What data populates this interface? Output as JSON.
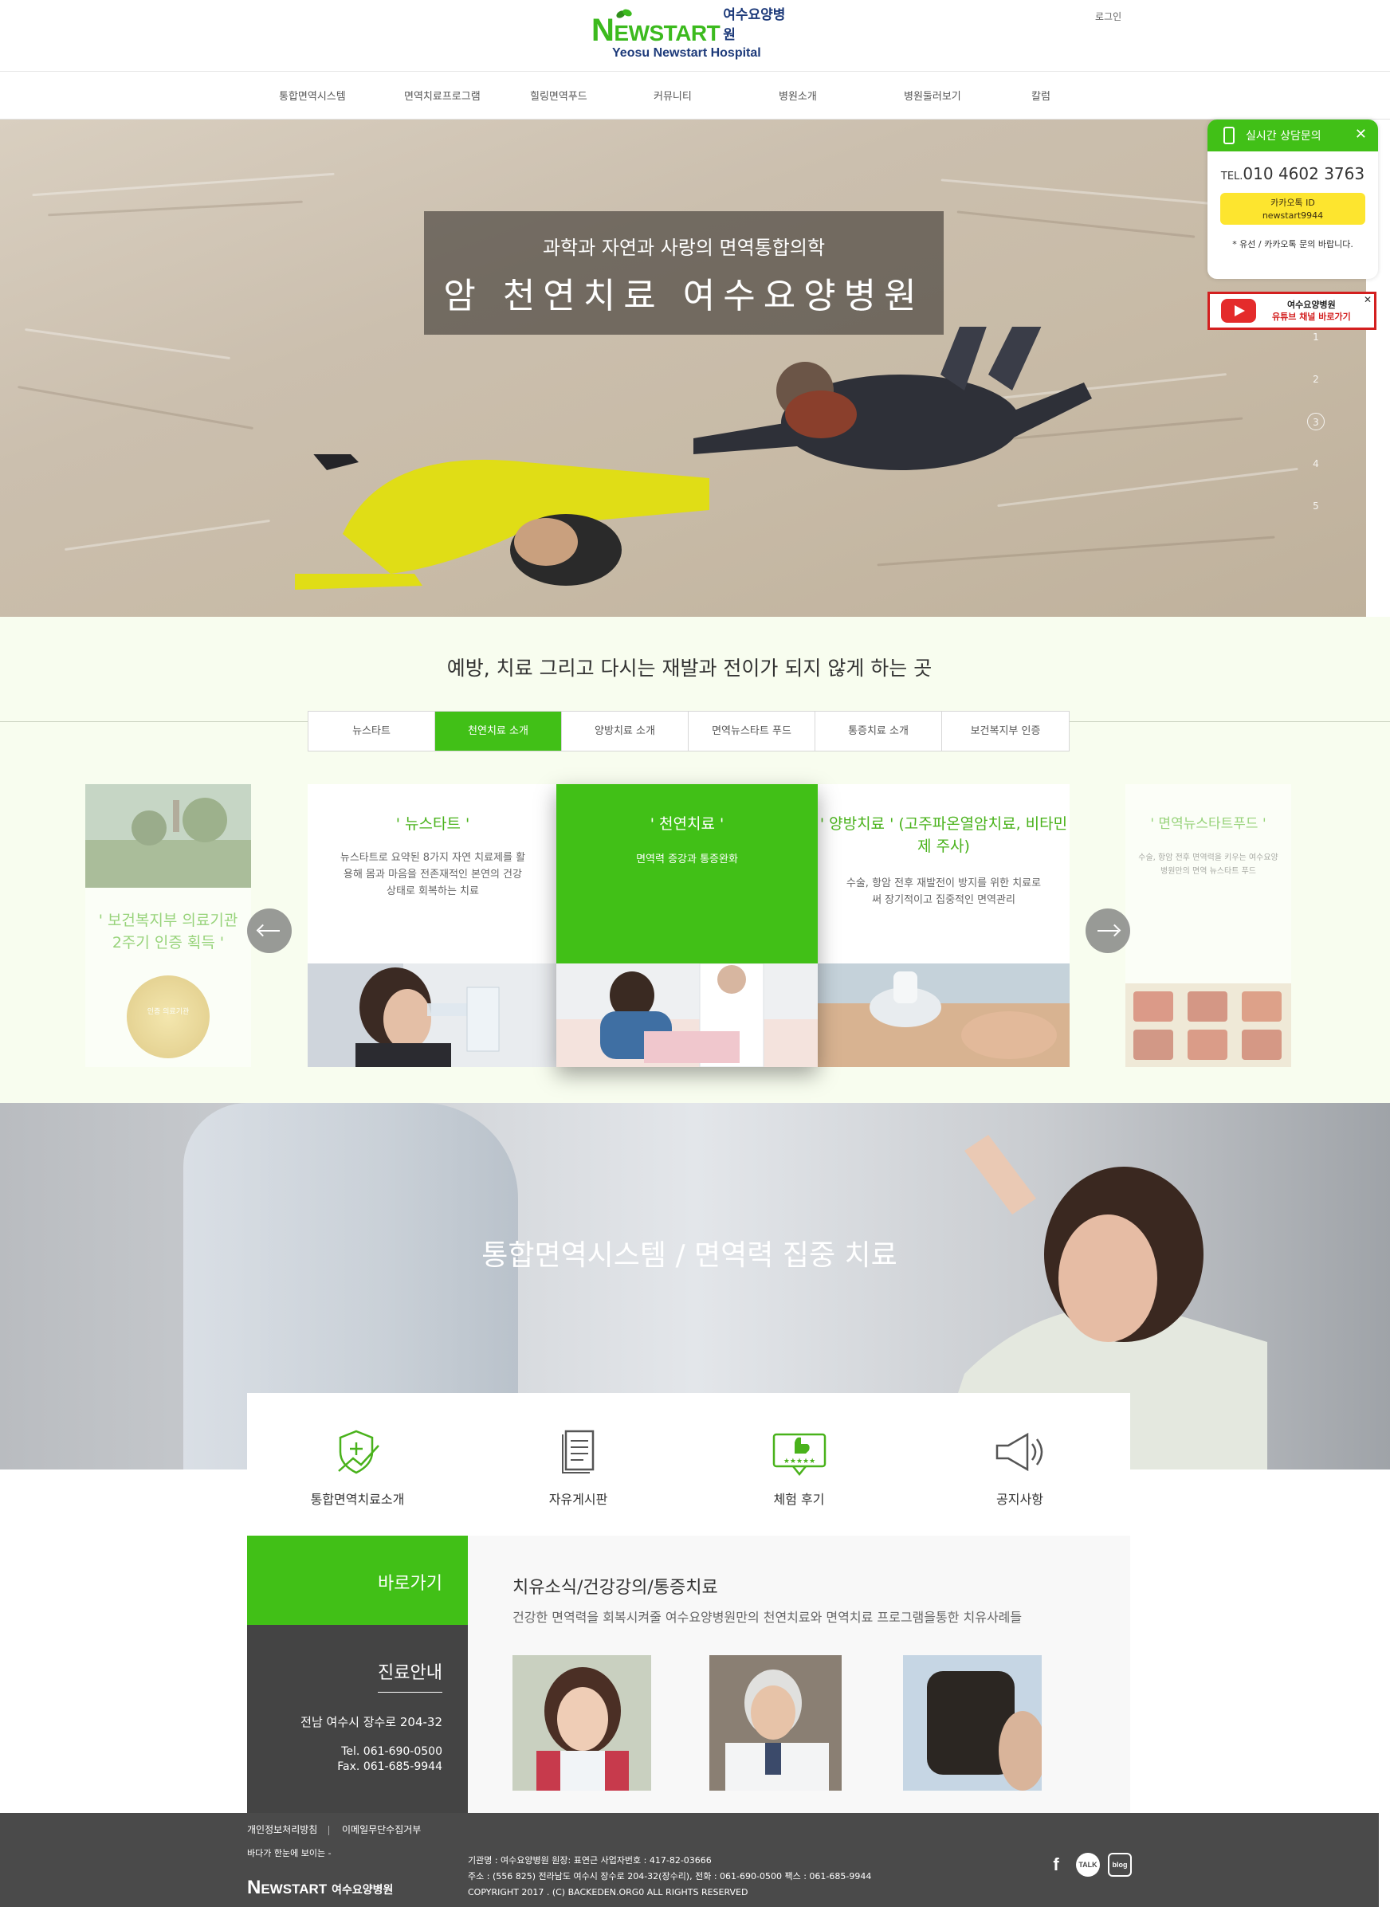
{
  "header": {
    "logo_brand_first": "N",
    "logo_brand_rest": "EWSTART",
    "logo_ko": "여수요양병원",
    "logo_en": "Yeosu Newstart Hospital",
    "login": "로그인"
  },
  "nav": [
    "통합면역시스템",
    "면역치료프로그램",
    "힐링면역푸드",
    "커뮤니티",
    "병원소개",
    "병원둘러보기",
    "칼럼"
  ],
  "hero": {
    "subtitle": "과학과 자연과 사랑의 면역통합의학",
    "title": "암 천연치료 여수요양병원",
    "slides": [
      "1",
      "2",
      "3",
      "4",
      "5"
    ],
    "active_slide": 3
  },
  "consult_widget": {
    "title": "실시간 상담문의",
    "close": "✕",
    "tel_prefix": "TEL.",
    "tel": "010 4602 3763",
    "kakao_label": "카카오톡 ID",
    "kakao_id": "newstart9944",
    "note": "* 유선 / 카카오톡 문의 바랍니다."
  },
  "youtube_banner": {
    "line1": "여수요양병원",
    "line2": "유튜브 채널 바로가기",
    "close": "✕"
  },
  "section2": {
    "headline": "예방, 치료 그리고 다시는 재발과 전이가 되지 않게 하는 곳",
    "tabs": [
      "뉴스타트",
      "천연치료 소개",
      "양방치료 소개",
      "면역뉴스타트 푸드",
      "통증치료 소개",
      "보건복지부 인증"
    ],
    "active_tab": 1,
    "cards": [
      {
        "title": "' 보건복지부 의료기관 2주기 인증 획득 '",
        "desc": "",
        "badge": "인증 의료기관"
      },
      {
        "title": "' 뉴스타트 '",
        "desc": "뉴스타트로 요약된 8가지 자연 치료제를 활용해 몸과 마음을 전존재적인 본연의 건강상태로 회복하는 치료"
      },
      {
        "title": "' 천연치료 '",
        "desc": "면역력 증강과 통증완화"
      },
      {
        "title": "' 양방치료 ' (고주파온열암치료, 비타민제 주사)",
        "desc": "수술, 항암 전후 재발전이 방지를 위한 치료로써 장기적이고 집중적인 면역관리"
      },
      {
        "title": "' 면역뉴스타트푸드 '",
        "desc": "수술, 항암 전후 면역력을 키우는 여수요양병원만의 면역 뉴스타트 푸드"
      }
    ]
  },
  "section3": {
    "headline": "통합면역시스템 / 면역력 집중 치료",
    "icons": [
      {
        "label": "통합면역치료소개",
        "icon": "shield-cross-icon"
      },
      {
        "label": "자유게시판",
        "icon": "document-icon"
      },
      {
        "label": "체험 후기",
        "icon": "thumbs-up-review-icon"
      },
      {
        "label": "공지사항",
        "icon": "megaphone-icon"
      }
    ]
  },
  "quick": {
    "label": "바로가기"
  },
  "clinic": {
    "heading": "진료안내",
    "address": "전남 여수시 장수로 204-32",
    "tel": "Tel. 061-690-0500",
    "fax": "Fax. 061-685-9944"
  },
  "news": {
    "title": "치유소식/건강강의/통증치료",
    "desc": "건강한 면역력을 회복시켜줄 여수요양병원만의 천연치료와 면역치료 프로그램을통한 치유사례들"
  },
  "footer": {
    "privacy": "개인정보처리방침",
    "email_policy": "이메일무단수집거부",
    "slogan": "바다가 한눈에 보이는 -",
    "logo_first": "N",
    "logo_rest": "EWSTART",
    "logo_ko": "여수요양병원",
    "info1": "기관명 : 여수요양병원 원장: 표연근 사업자번호 : 417-82-03666",
    "info2": "주소 : (556 825) 전라남도 여수시 장수로 204-32(장수리), 전화 : 061-690-0500 팩스 : 061-685-9944",
    "info3": "COPYRIGHT 2017 . (C) BACKEDEN.ORG0 ALL RIGHTS RESERVED",
    "social": [
      "f",
      "TALK",
      "blog"
    ]
  },
  "colors": {
    "brand_green": "#41c017",
    "brand_navy": "#1d3a7a",
    "dark_panel": "#444444",
    "footer_bg": "#4a4a4a",
    "youtube_red": "#d31f1f",
    "kakao_yellow": "#fde52f"
  }
}
